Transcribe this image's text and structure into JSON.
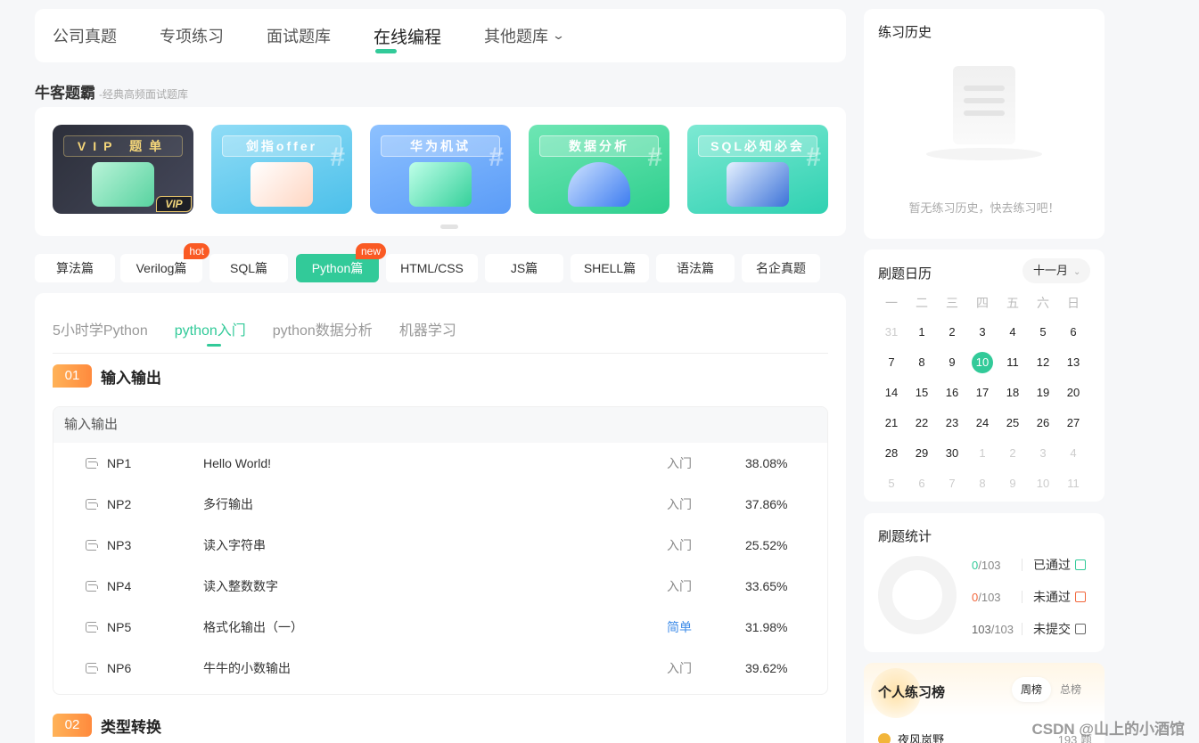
{
  "nav": {
    "items": [
      "公司真题",
      "专项练习",
      "面试题库",
      "在线编程",
      "其他题库"
    ],
    "active": "在线编程"
  },
  "bank": {
    "title": "牛客题霸",
    "subtitle": "-经典高频面试题库"
  },
  "banners": [
    {
      "label": "VIP 题单",
      "tag": "VIP"
    },
    {
      "label": "剑指offer"
    },
    {
      "label": "华为机试"
    },
    {
      "label": "数据分析"
    },
    {
      "label": "SQL必知必会"
    }
  ],
  "categories": [
    {
      "label": "算法篇"
    },
    {
      "label": "Verilog篇",
      "badge": "hot"
    },
    {
      "label": "SQL篇"
    },
    {
      "label": "Python篇",
      "badge": "new",
      "active": true
    },
    {
      "label": "HTML/CSS"
    },
    {
      "label": "JS篇"
    },
    {
      "label": "SHELL篇"
    },
    {
      "label": "语法篇"
    },
    {
      "label": "名企真题"
    }
  ],
  "subtabs": [
    "5小时学Python",
    "python入门",
    "python数据分析",
    "机器学习"
  ],
  "sections": [
    {
      "num": "01",
      "title": "输入输出",
      "group": "输入输出",
      "questions": [
        {
          "id": "NP1",
          "title": "Hello World!",
          "difficulty": "入门",
          "rate": "38.08%"
        },
        {
          "id": "NP2",
          "title": "多行输出",
          "difficulty": "入门",
          "rate": "37.86%"
        },
        {
          "id": "NP3",
          "title": "读入字符串",
          "difficulty": "入门",
          "rate": "25.52%"
        },
        {
          "id": "NP4",
          "title": "读入整数数字",
          "difficulty": "入门",
          "rate": "33.65%"
        },
        {
          "id": "NP5",
          "title": "格式化输出（一）",
          "difficulty": "简单",
          "rate": "31.98%"
        },
        {
          "id": "NP6",
          "title": "牛牛的小数输出",
          "difficulty": "入门",
          "rate": "39.62%"
        }
      ]
    },
    {
      "num": "02",
      "title": "类型转换"
    }
  ],
  "history": {
    "title": "练习历史",
    "empty_text": "暂无练习历史，快去练习吧！"
  },
  "calendar": {
    "title": "刷题日历",
    "month": "十一月",
    "weekdays": [
      "一",
      "二",
      "三",
      "四",
      "五",
      "六",
      "日"
    ],
    "days": [
      {
        "d": "31",
        "muted": true
      },
      {
        "d": "1"
      },
      {
        "d": "2"
      },
      {
        "d": "3"
      },
      {
        "d": "4"
      },
      {
        "d": "5"
      },
      {
        "d": "6"
      },
      {
        "d": "7"
      },
      {
        "d": "8"
      },
      {
        "d": "9"
      },
      {
        "d": "10",
        "today": true
      },
      {
        "d": "11"
      },
      {
        "d": "12"
      },
      {
        "d": "13"
      },
      {
        "d": "14"
      },
      {
        "d": "15"
      },
      {
        "d": "16"
      },
      {
        "d": "17"
      },
      {
        "d": "18"
      },
      {
        "d": "19"
      },
      {
        "d": "20"
      },
      {
        "d": "21"
      },
      {
        "d": "22"
      },
      {
        "d": "23"
      },
      {
        "d": "24"
      },
      {
        "d": "25"
      },
      {
        "d": "26"
      },
      {
        "d": "27"
      },
      {
        "d": "28"
      },
      {
        "d": "29"
      },
      {
        "d": "30"
      },
      {
        "d": "1",
        "muted": true
      },
      {
        "d": "2",
        "muted": true
      },
      {
        "d": "3",
        "muted": true
      },
      {
        "d": "4",
        "muted": true
      },
      {
        "d": "5",
        "muted": true
      },
      {
        "d": "6",
        "muted": true
      },
      {
        "d": "7",
        "muted": true
      },
      {
        "d": "8",
        "muted": true
      },
      {
        "d": "9",
        "muted": true
      },
      {
        "d": "10",
        "muted": true
      },
      {
        "d": "11",
        "muted": true
      }
    ]
  },
  "stats": {
    "title": "刷题统计",
    "passed": {
      "count": "0",
      "total": "/103",
      "label": "已通过"
    },
    "failed": {
      "count": "0",
      "total": "/103",
      "label": "未通过"
    },
    "unsubmitted": {
      "count": "103",
      "total": "/103",
      "label": "未提交"
    }
  },
  "rank": {
    "title": "个人练习榜",
    "tabs": [
      "周榜",
      "总榜"
    ],
    "top": {
      "name": "夜风岚野",
      "count": "193 题"
    }
  },
  "watermark": "CSDN @山上的小酒馆",
  "colors": {
    "accent": "#32ca99",
    "badge": "#fa5a24",
    "section": "#ff8a3d",
    "easy": "#3f8ce8"
  }
}
